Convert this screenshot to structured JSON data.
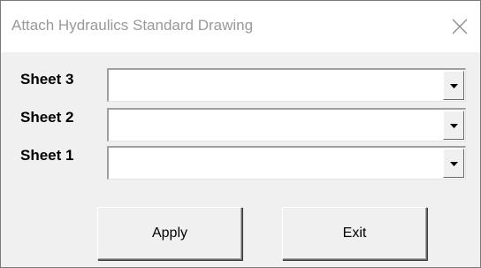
{
  "window": {
    "title": "Attach Hydraulics Standard Drawing",
    "close_icon": "close-icon",
    "background": "#f0f0f0",
    "titlebar_background": "#ffffff"
  },
  "sheets": [
    {
      "label": "Sheet 3",
      "value": "",
      "arrow_icon": "dropdown-arrow-icon"
    },
    {
      "label": "Sheet 2",
      "value": "",
      "arrow_icon": "dropdown-arrow-icon"
    },
    {
      "label": "Sheet 1",
      "value": "",
      "arrow_icon": "dropdown-arrow-icon"
    }
  ],
  "buttons": {
    "apply_label": "Apply",
    "exit_label": "Exit"
  }
}
